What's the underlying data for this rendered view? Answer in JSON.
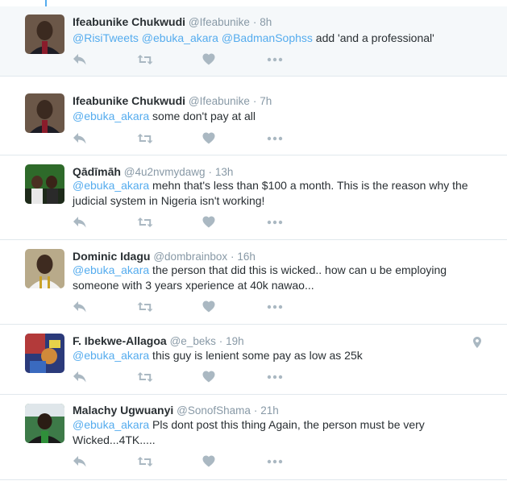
{
  "tweets": [
    {
      "name": "Ifeabunike Chukwudi",
      "handle": "@Ifeabunike",
      "sep": "·",
      "time": "8h",
      "mentions": [
        "@RisiTweets",
        "@ebuka_akara",
        "@BadmanSophss"
      ],
      "text": " add 'and a professional'",
      "avatar_colors": [
        "#5a4636",
        "#2a1f1a"
      ]
    },
    {
      "name": "Ifeabunike Chukwudi",
      "handle": "@Ifeabunike",
      "sep": "·",
      "time": "7h",
      "mentions": [
        "@ebuka_akara"
      ],
      "text": " some don't pay at all",
      "avatar_colors": [
        "#5a4636",
        "#2a1f1a"
      ]
    },
    {
      "name": "Qādīmāh",
      "handle": "@4u2nvmydawg",
      "sep": "·",
      "time": "13h",
      "mentions": [
        "@ebuka_akara"
      ],
      "text": " mehn that's less than $100 a month. This is the reason why the judicial system in Nigeria isn't working!",
      "avatar_colors": [
        "#3d7a2c",
        "#1c2e18"
      ]
    },
    {
      "name": "Dominic Idagu",
      "handle": "@dombrainbox",
      "sep": "·",
      "time": "16h",
      "mentions": [
        "@ebuka_akara"
      ],
      "text": " the person that did this is wicked.. how can u be employing someone with 3 years xperience at 40k nawao...",
      "avatar_colors": [
        "#9a8a6a",
        "#3e2b20"
      ]
    },
    {
      "name": "F. Ibekwe-Allagoa",
      "handle": "@e_beks",
      "sep": "·",
      "time": "19h",
      "mentions": [
        "@ebuka_akara"
      ],
      "text": " this guy is lenient some pay as low as 25k",
      "avatar_colors": [
        "#b33a3a",
        "#2b3a7a"
      ]
    },
    {
      "name": "Malachy Ugwuanyi",
      "handle": "@SonofShama",
      "sep": "·",
      "time": "21h",
      "mentions": [
        "@ebuka_akara"
      ],
      "text": " Pls dont post this thing Again, the person must be very Wicked...4TK.....",
      "avatar_colors": [
        "#2f6b3a",
        "#1a1a1a"
      ]
    }
  ],
  "colors": {
    "link": "#55acee",
    "icon": "#aab8c2",
    "meta": "#8899a6",
    "highlight": "#f5f8fa"
  },
  "icons": [
    "reply-icon",
    "retweet-icon",
    "like-icon",
    "more-icon",
    "location-pin-icon"
  ]
}
